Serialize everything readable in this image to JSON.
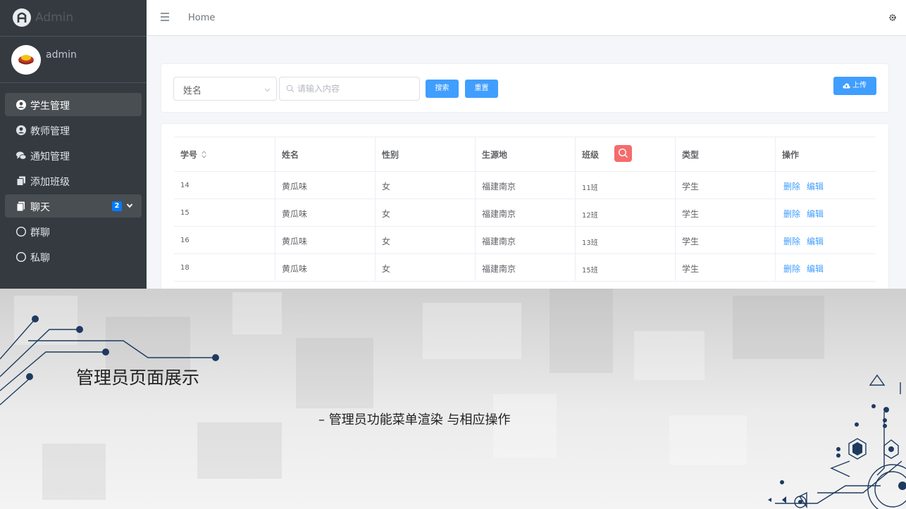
{
  "app": {
    "brand": "Admin",
    "user_name": "admin"
  },
  "sidebar": {
    "items": [
      {
        "label": "学生管理",
        "icon": "user-circle-icon",
        "active": true
      },
      {
        "label": "教师管理",
        "icon": "user-circle-icon"
      },
      {
        "label": "通知管理",
        "icon": "comments-icon"
      },
      {
        "label": "添加班级",
        "icon": "copy-icon"
      },
      {
        "label": "聊天",
        "icon": "file-icon",
        "badge": "2",
        "active": true
      },
      {
        "label": "群聊",
        "icon": "circle-outline-icon"
      },
      {
        "label": "私聊",
        "icon": "circle-outline-icon"
      }
    ]
  },
  "topbar": {
    "home": "Home"
  },
  "search": {
    "field_value": "姓名",
    "placeholder": "请输入内容",
    "search_label": "搜索",
    "reset_label": "重置",
    "upload_label": "上传"
  },
  "table": {
    "headers": [
      "学号",
      "姓名",
      "性别",
      "生源地",
      "班级",
      "类型",
      "操作"
    ],
    "rows": [
      {
        "id": "14",
        "name": "黄瓜味",
        "gender": "女",
        "origin": "福建南京",
        "class": "11班",
        "type": "学生"
      },
      {
        "id": "15",
        "name": "黄瓜味",
        "gender": "女",
        "origin": "福建南京",
        "class": "12班",
        "type": "学生"
      },
      {
        "id": "16",
        "name": "黄瓜味",
        "gender": "女",
        "origin": "福建南京",
        "class": "13班",
        "type": "学生"
      },
      {
        "id": "18",
        "name": "黄瓜味",
        "gender": "女",
        "origin": "福建南京",
        "class": "15班",
        "type": "学生"
      }
    ],
    "delete_label": "删除",
    "edit_label": "编辑"
  },
  "slide": {
    "title": "管理员页面展示",
    "subtitle": "–  管理员功能菜单渲染 与相应操作"
  },
  "colors": {
    "sidebar_bg": "#343a40",
    "primary": "#409eff",
    "danger": "#f56c6c",
    "badge": "#007bff"
  }
}
